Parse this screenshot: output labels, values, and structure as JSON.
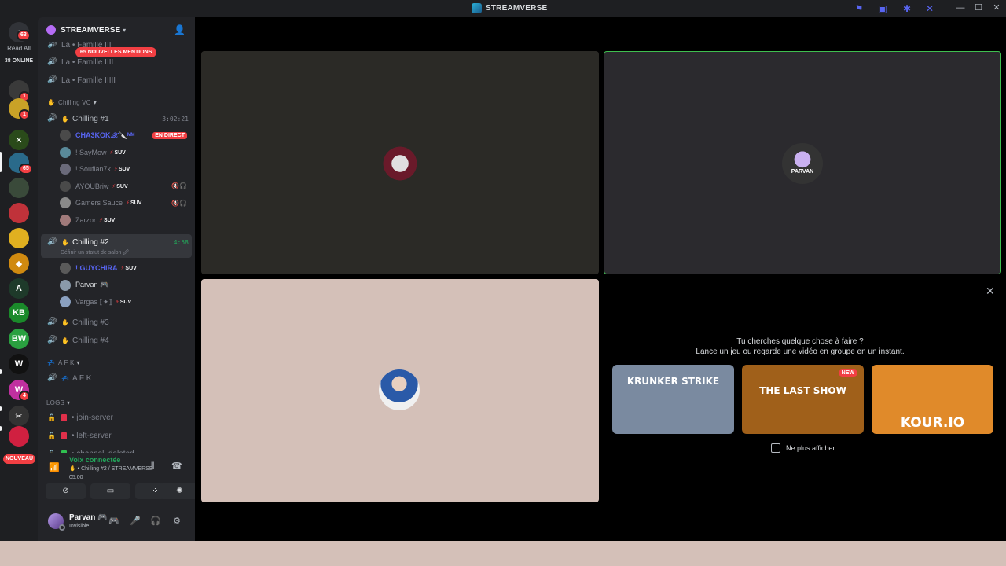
{
  "window": {
    "title": "STREAMVERSE",
    "controls": [
      "minimize",
      "maximize",
      "close"
    ]
  },
  "rail": {
    "home_badge": "63",
    "read_all": "Read All",
    "online_count": "38 ONLINE",
    "servers": [
      {
        "name": "server-1",
        "badge": "1",
        "color": "#3a3a3a",
        "glyph": ""
      },
      {
        "name": "server-2",
        "badge": "1",
        "color": "#c9a227",
        "glyph": ""
      },
      {
        "name": "server-3",
        "badge": "",
        "color": "#2a4a1a",
        "glyph": "✕"
      },
      {
        "name": "server-4",
        "badge": "65",
        "color": "#2a6a8a",
        "glyph": ""
      },
      {
        "name": "server-5",
        "badge": "",
        "color": "#3a4a3a",
        "glyph": ""
      },
      {
        "name": "server-6",
        "badge": "",
        "color": "#c0323a",
        "glyph": ""
      },
      {
        "name": "server-7",
        "badge": "",
        "color": "#e0b020",
        "glyph": ""
      },
      {
        "name": "server-8",
        "badge": "",
        "color": "#d08a10",
        "glyph": "◆"
      },
      {
        "name": "server-9",
        "badge": "",
        "color": "#1e3a2a",
        "glyph": "A"
      },
      {
        "name": "server-10",
        "badge": "",
        "color": "#1a8a2a",
        "glyph": "KB"
      },
      {
        "name": "server-11",
        "badge": "",
        "color": "#2aa040",
        "glyph": "BW"
      },
      {
        "name": "server-12",
        "badge": "",
        "color": "#111",
        "glyph": "W"
      },
      {
        "name": "server-13",
        "badge": "4",
        "color": "#c030a0",
        "glyph": "W"
      },
      {
        "name": "server-14",
        "badge": "",
        "color": "#333",
        "glyph": "✂"
      },
      {
        "name": "server-15",
        "badge": "",
        "color": "#d02040",
        "glyph": ""
      }
    ],
    "new_label": "NOUVEAU"
  },
  "sidebar": {
    "server_name": "STREAMVERSE",
    "mentions_pill": "65 NOUVELLES MENTIONS",
    "channels_top": [
      {
        "label": "La • Famille III"
      },
      {
        "label": "La • Famille IIII"
      },
      {
        "label": "La • Famille IIIII"
      }
    ],
    "category_chilling": "Chilling VC",
    "chilling1": {
      "label": "Chilling #1",
      "timer": "3:02:21"
    },
    "chilling1_users": [
      {
        "name": "CHA3KOK.𝒳🔪ᴹᴹ",
        "tag": "",
        "live": "EN DIRECT",
        "color": "#4a4a4a"
      },
      {
        "name": "! SayMow",
        "tag": "SUV",
        "live": "",
        "color": "#5a8a9a"
      },
      {
        "name": "! Soufian7k",
        "tag": "SUV",
        "live": "",
        "color": "#6a6a7a"
      },
      {
        "name": "AYOUBriw",
        "tag": "SUV",
        "live": "",
        "color": "#4a4a4a",
        "icons": "🔇🎧"
      },
      {
        "name": "Gamers Sauce",
        "tag": "SUV",
        "live": "",
        "color": "#8a8a8a",
        "icons": "🔇🎧"
      },
      {
        "name": "Zarzor",
        "tag": "SUV",
        "live": "",
        "color": "#a07a7a"
      }
    ],
    "chilling2": {
      "label": "Chilling #2",
      "timer": "4:58",
      "status_hint": "Définir un statut de salon 🖉"
    },
    "chilling2_users": [
      {
        "name": "! GUYCHIRA",
        "tag": "SUV",
        "color": "#5a5a5a"
      },
      {
        "name": "Parvan 🎮",
        "tag": "",
        "color": "#8a9aaa"
      },
      {
        "name": "Vargas ⟦✦⟧",
        "tag": "SUV",
        "color": "#8aa0c0"
      }
    ],
    "chilling3": "Chilling #3",
    "chilling4": "Chilling #4",
    "category_afk": "A F K",
    "afk_channel": "A F K",
    "category_logs": "LOGS",
    "logs": [
      {
        "label": "join-server",
        "color": "#e0304a"
      },
      {
        "label": "left-server",
        "color": "#e0304a"
      },
      {
        "label": "channel_deleted",
        "color": "#30c050"
      }
    ]
  },
  "voice": {
    "status": "Voix connectée",
    "channel": "Chilling #2 / STREAMVERSE",
    "elapsed": "05:00"
  },
  "user": {
    "name": "Parvan 🎮",
    "status": "Invisible"
  },
  "stage": {
    "promo_line1": "Tu cherches quelque chose à faire ?",
    "promo_line2": "Lance un jeu ou regarde une vidéo en groupe en un instant.",
    "games": [
      {
        "title": "KRUNKER STRIKE",
        "new": "",
        "bg": "#7a8aa0"
      },
      {
        "title": "THE LAST SHOW",
        "new": "NEW",
        "bg": "#a0601a"
      },
      {
        "title": "KOUR.IO",
        "new": "",
        "bg": "#e08a2a"
      }
    ],
    "dont_show": "Ne plus afficher",
    "avatar2_text": "PARVAN"
  }
}
